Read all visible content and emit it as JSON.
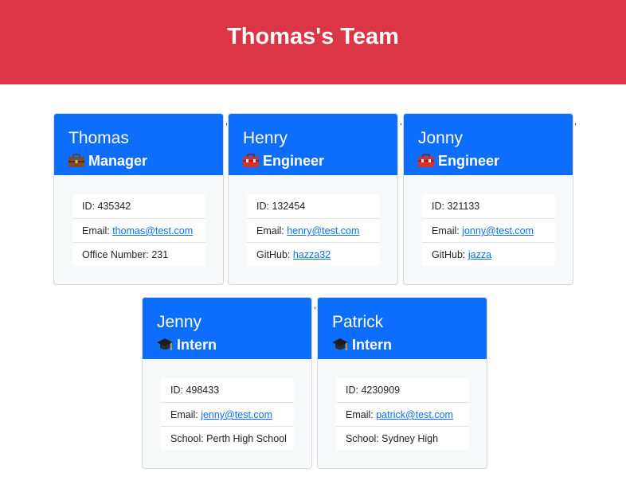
{
  "header": {
    "title": "Thomas's Team"
  },
  "team": [
    {
      "name": "Thomas",
      "role": "Manager",
      "icon": "briefcase-icon",
      "id_label": "ID: ",
      "id": "435342",
      "email_label": "Email: ",
      "email": "thomas@test.com",
      "extra_label": "Office Number: ",
      "extra": "231",
      "extra_is_link": false
    },
    {
      "name": "Henry",
      "role": "Engineer",
      "icon": "toolbox-icon",
      "id_label": "ID: ",
      "id": "132454",
      "email_label": "Email: ",
      "email": "henry@test.com",
      "extra_label": "GitHub: ",
      "extra": "hazza32",
      "extra_is_link": true
    },
    {
      "name": "Jonny",
      "role": "Engineer",
      "icon": "toolbox-icon",
      "id_label": "ID: ",
      "id": "321133",
      "email_label": "Email: ",
      "email": "jonny@test.com",
      "extra_label": "GitHub: ",
      "extra": "jazza",
      "extra_is_link": true
    },
    {
      "name": "Jenny",
      "role": "Intern",
      "icon": "graduation-cap-icon",
      "id_label": "ID: ",
      "id": "498433",
      "email_label": "Email: ",
      "email": "jenny@test.com",
      "extra_label": "School: ",
      "extra": "Perth High School",
      "extra_is_link": false
    },
    {
      "name": "Patrick",
      "role": "Intern",
      "icon": "graduation-cap-icon",
      "id_label": "ID: ",
      "id": "4230909",
      "email_label": "Email: ",
      "email": "patrick@test.com",
      "extra_label": "School: ",
      "extra": "Sydney High",
      "extra_is_link": false
    }
  ],
  "separator": ","
}
